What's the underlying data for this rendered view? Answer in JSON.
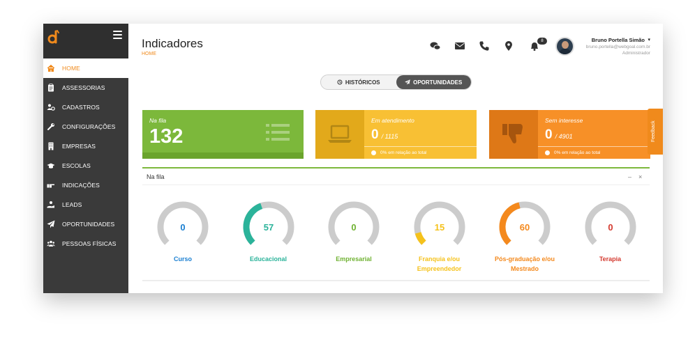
{
  "sidebar": {
    "items": [
      {
        "label": "HOME",
        "icon": "home-icon",
        "active": true
      },
      {
        "label": "ASSESSORIAS",
        "icon": "clipboard-icon",
        "active": false
      },
      {
        "label": "CADASTROS",
        "icon": "users-gear-icon",
        "active": false
      },
      {
        "label": "CONFIGURAÇÕES",
        "icon": "wrench-icon",
        "active": false
      },
      {
        "label": "EMPRESAS",
        "icon": "building-icon",
        "active": false
      },
      {
        "label": "ESCOLAS",
        "icon": "graduation-cap-icon",
        "active": false
      },
      {
        "label": "INDICAÇÕES",
        "icon": "hand-point-icon",
        "active": false
      },
      {
        "label": "LEADS",
        "icon": "hand-coin-icon",
        "active": false
      },
      {
        "label": "OPORTUNIDADES",
        "icon": "paper-plane-icon",
        "active": false
      },
      {
        "label": "PESSOAS FÍSICAS",
        "icon": "people-icon",
        "active": false
      }
    ]
  },
  "header": {
    "title": "Indicadores",
    "breadcrumb": "HOME",
    "notification_count": "8",
    "user": {
      "name": "Bruno Portella Simão",
      "email": "bruno.portella@webgoal.com.br",
      "role": "Administrador"
    }
  },
  "tabs": [
    {
      "label": "HISTÓRICOS",
      "icon": "history-icon",
      "active": false
    },
    {
      "label": "OPORTUNIDADES",
      "icon": "paper-plane-icon",
      "active": true
    }
  ],
  "cards": {
    "queue": {
      "label": "Na fila",
      "value": "132",
      "color": "#7cb83b"
    },
    "in_service": {
      "label": "Em atendimento",
      "value": "0",
      "total": "/ 1115",
      "percent_text": "0% em relação ao total",
      "color": "#f8c034"
    },
    "no_interest": {
      "label": "Sem interesse",
      "value": "0",
      "total": "/ 4901",
      "percent_text": "0% em relação ao total",
      "color": "#f79027"
    }
  },
  "feedback_label": "Feedback",
  "panel": {
    "title": "Na fila",
    "minimize": "–",
    "close": "×",
    "gauges": [
      {
        "value": 0,
        "label_lines": [
          "Curso"
        ],
        "color": "#1a7fd1",
        "fill": 0
      },
      {
        "value": 57,
        "label_lines": [
          "Educacional"
        ],
        "color": "#2bb39a",
        "fill": 0.43
      },
      {
        "value": 0,
        "label_lines": [
          "Empresarial"
        ],
        "color": "#6fb232",
        "fill": 0
      },
      {
        "value": 15,
        "label_lines": [
          "Franquia e/ou",
          "Empreendedor"
        ],
        "color": "#f5c21c",
        "fill": 0.11
      },
      {
        "value": 60,
        "label_lines": [
          "Pós-graduação e/ou",
          "Mestrado"
        ],
        "color": "#f4891d",
        "fill": 0.45
      },
      {
        "value": 0,
        "label_lines": [
          "Terapia"
        ],
        "color": "#d43a2f",
        "fill": 0
      }
    ]
  }
}
